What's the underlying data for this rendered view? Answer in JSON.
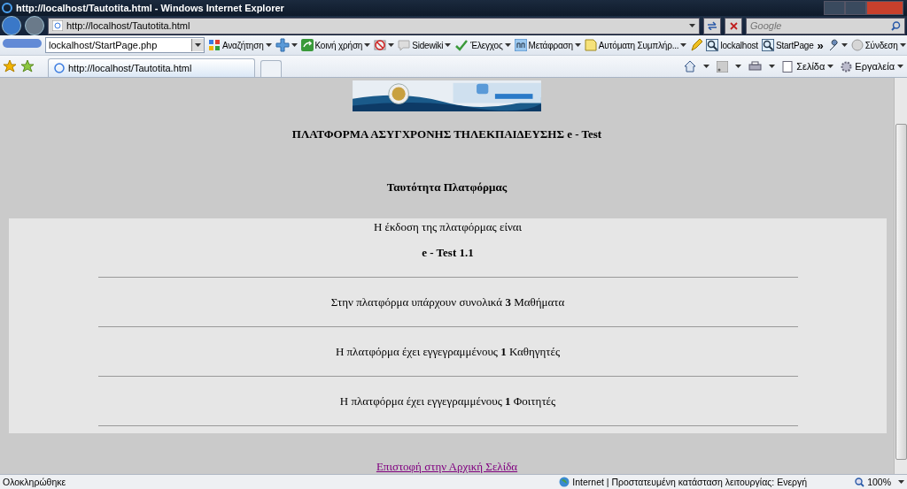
{
  "window": {
    "title": "http://localhost/Tautotita.html - Windows Internet Explorer"
  },
  "navigation": {
    "address": "http://localhost/Tautotita.html",
    "search_placeholder": "Google"
  },
  "google_toolbar": {
    "search_value": "lockalhost/StartPage.php",
    "items": [
      {
        "kind": "text",
        "label": "Αναζήτηση",
        "dropdown": true
      },
      {
        "kind": "icon",
        "dropdown": true
      },
      {
        "kind": "text",
        "label": "Κοινή χρήση",
        "dropdown": true
      },
      {
        "kind": "icon",
        "dropdown": true
      },
      {
        "kind": "text",
        "label": "Sidewiki",
        "dropdown": true
      },
      {
        "kind": "text",
        "label": "Έλεγχος",
        "dropdown": true
      },
      {
        "kind": "text",
        "label": "Μετάφραση",
        "dropdown": true
      },
      {
        "kind": "text",
        "label": "Αυτόματη Συμπλήρ...",
        "dropdown": true
      },
      {
        "kind": "icon",
        "dropdown": false
      },
      {
        "kind": "text",
        "label": "lockalhost",
        "dropdown": false
      },
      {
        "kind": "text",
        "label": "StartPage",
        "dropdown": false
      },
      {
        "kind": "more",
        "label": "»",
        "dropdown": false
      },
      {
        "kind": "icon",
        "dropdown": true
      },
      {
        "kind": "text",
        "label": "Σύνδεση",
        "dropdown": true
      }
    ]
  },
  "tabs": [
    {
      "title": "http://localhost/Tautotita.html",
      "selected": true
    }
  ],
  "command_bar": {
    "items": [
      "Σελίδα",
      "Εργαλεία"
    ]
  },
  "page": {
    "heading": "ΠΛΑΤΦΟΡΜΑ ΑΣΥΓΧΡΟΝΗΣ ΤΗΛΕΚΠΑΙΔΕΥΣΗΣ e - Test",
    "subheading": "Ταυτότητα Πλατφόρμας",
    "version_label": "Η έκδοση της πλατφόρμας είναι",
    "version": "e - Test 1.1",
    "stats": [
      "Στην πλατφόρμα υπάρχουν συνολικά **3** Μαθήματα",
      "Η πλατφόρμα έχει εγγεγραμμένους **1** Καθηγητές",
      "Η πλατφόρμα έχει εγγεγραμμένους **1** Φοιτητές"
    ],
    "link": "Επιστοφή στην Αρχική Σελίδα"
  },
  "status_bar": {
    "text": "Ολοκληρώθηκε",
    "zone": "Internet | Προστατευμένη κατάσταση λειτουργίας: Ενεργή",
    "zoom": "100%"
  }
}
